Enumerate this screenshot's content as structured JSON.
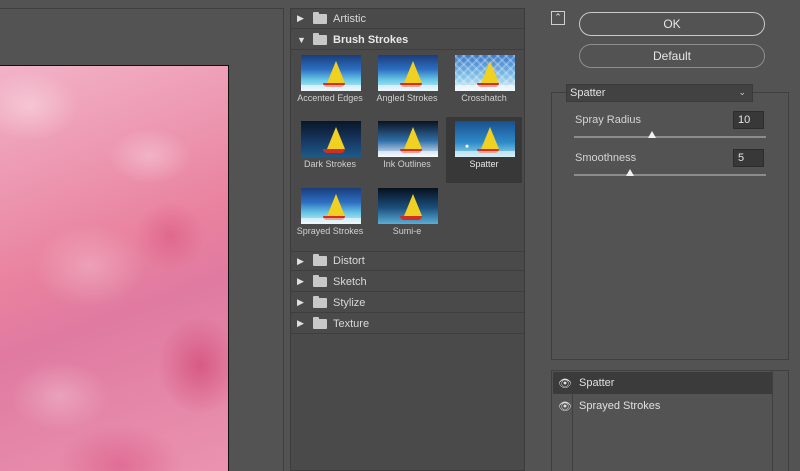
{
  "gallery": {
    "categories": [
      {
        "label": "Artistic",
        "expanded": false
      },
      {
        "label": "Brush Strokes",
        "expanded": true
      },
      {
        "label": "Distort",
        "expanded": false
      },
      {
        "label": "Sketch",
        "expanded": false
      },
      {
        "label": "Stylize",
        "expanded": false
      },
      {
        "label": "Texture",
        "expanded": false
      }
    ],
    "thumbnails": [
      {
        "label": "Accented Edges",
        "selected": false
      },
      {
        "label": "Angled Strokes",
        "selected": false
      },
      {
        "label": "Crosshatch",
        "selected": false
      },
      {
        "label": "Dark Strokes",
        "selected": false
      },
      {
        "label": "Ink Outlines",
        "selected": false
      },
      {
        "label": "Spatter",
        "selected": true
      },
      {
        "label": "Sprayed Strokes",
        "selected": false
      },
      {
        "label": "Sumi-e",
        "selected": false
      }
    ]
  },
  "buttons": {
    "ok": "OK",
    "default": "Default"
  },
  "settings": {
    "filter": "Spatter",
    "params": [
      {
        "label": "Spray Radius",
        "value": "10",
        "slider_fraction": 0.4
      },
      {
        "label": "Smoothness",
        "value": "5",
        "slider_fraction": 0.33
      }
    ]
  },
  "effect_layers": [
    {
      "name": "Spatter",
      "visible": true,
      "active": true
    },
    {
      "name": "Sprayed Strokes",
      "visible": true,
      "active": false
    }
  ],
  "colors": {
    "panel_bg": "#535353",
    "gallery_bg": "#4a4a4a",
    "selected_bg": "#383838",
    "canvas_pink": "#e9829f"
  }
}
